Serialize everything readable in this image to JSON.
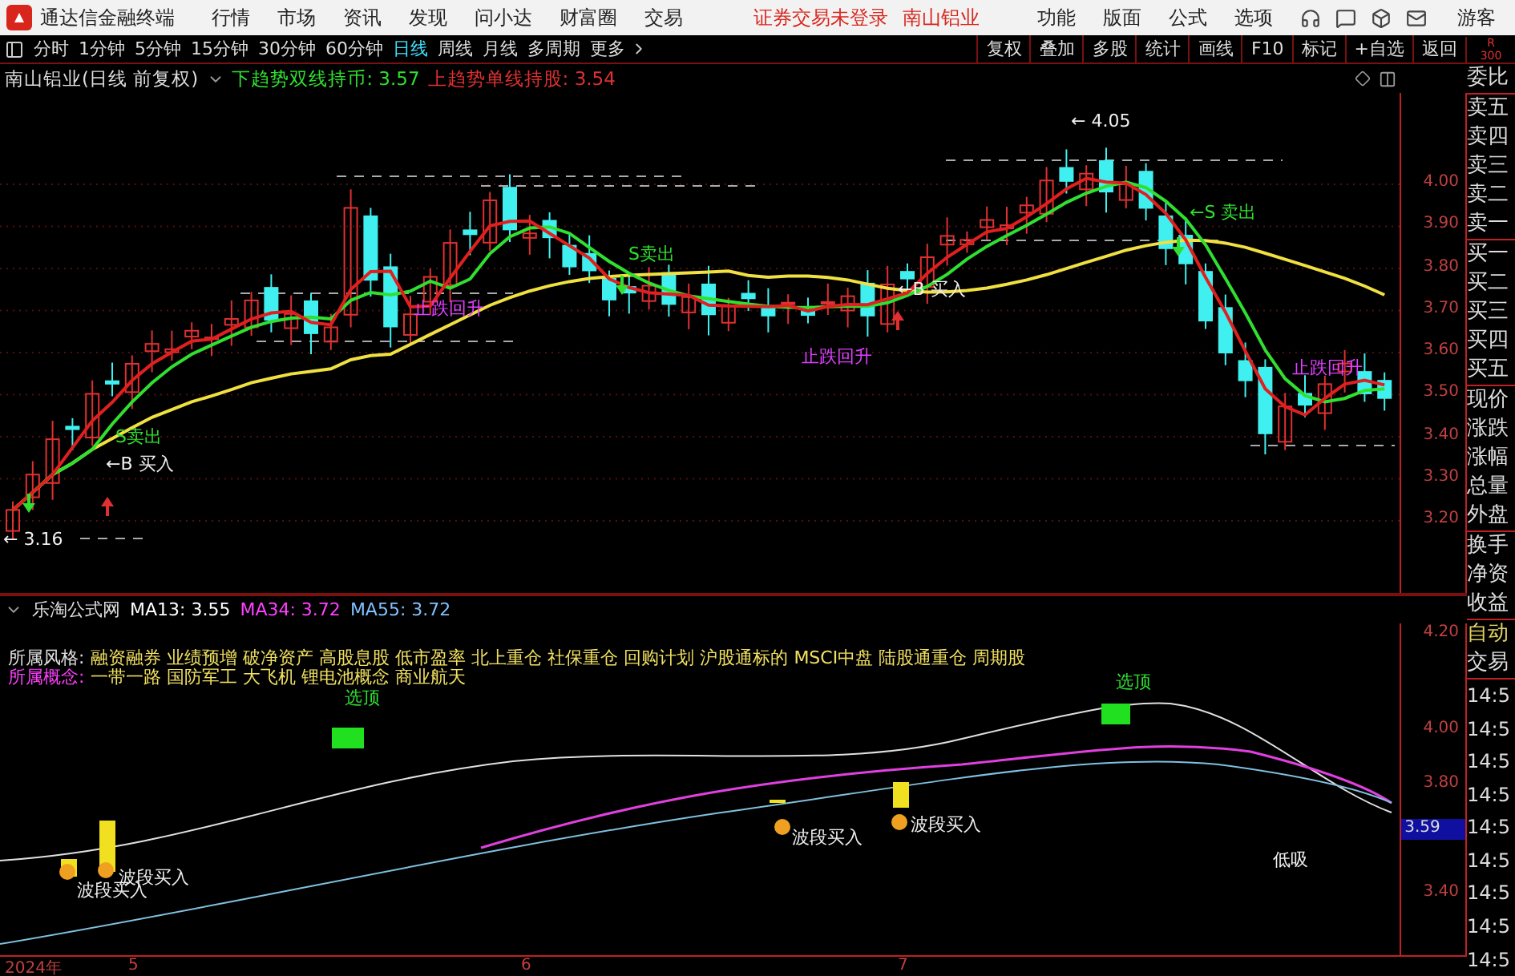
{
  "app": {
    "title": "通达信金融终端",
    "menu": [
      "行情",
      "市场",
      "资讯",
      "发现",
      "问小达",
      "财富圈",
      "交易"
    ],
    "login_status": "证券交易未登录",
    "stock_name": "南山铝业",
    "right_menu": [
      "功能",
      "版面",
      "公式",
      "选项"
    ],
    "user": "游客"
  },
  "period_bar": {
    "periods": [
      {
        "label": "分时",
        "selected": false
      },
      {
        "label": "1分钟",
        "selected": false
      },
      {
        "label": "5分钟",
        "selected": false
      },
      {
        "label": "15分钟",
        "selected": false
      },
      {
        "label": "30分钟",
        "selected": false
      },
      {
        "label": "60分钟",
        "selected": false
      },
      {
        "label": "日线",
        "selected": true
      },
      {
        "label": "周线",
        "selected": false
      },
      {
        "label": "月线",
        "selected": false
      },
      {
        "label": "多周期",
        "selected": false
      }
    ],
    "more": "更多",
    "tools": [
      "复权",
      "叠加",
      "多股",
      "统计",
      "画线",
      "F10",
      "标记",
      "+自选",
      "返回"
    ],
    "corner": [
      "R",
      "300"
    ]
  },
  "price_panel": {
    "title": "南山铝业(日线 前复权)",
    "indicators": [
      {
        "kind": "down",
        "label": "下趋势双线持币:",
        "value": "3.57"
      },
      {
        "kind": "up",
        "label": "上趋势单线持股:",
        "value": "3.54"
      }
    ],
    "y_ticks": [
      "4.00",
      "3.90",
      "3.80",
      "3.70",
      "3.60",
      "3.50",
      "3.40",
      "3.30",
      "3.20"
    ],
    "annotations": [
      {
        "kind": "low",
        "text": "← 3.16"
      },
      {
        "kind": "sell",
        "text": "S卖出"
      },
      {
        "kind": "buy",
        "text": "←B 买入"
      },
      {
        "kind": "rebound",
        "text": "止跌回升"
      },
      {
        "kind": "sell",
        "text": "S卖出"
      },
      {
        "kind": "rebound",
        "text": "止跌回升"
      },
      {
        "kind": "buy",
        "text": "←B 买入"
      },
      {
        "kind": "high",
        "text": "← 4.05"
      },
      {
        "kind": "sell",
        "text": "←S 卖出"
      },
      {
        "kind": "rebound",
        "text": "止跌回升"
      }
    ]
  },
  "indicator_panel": {
    "source": "乐淘公式网",
    "averages": [
      {
        "label": "MA13: 3.55",
        "color": "#ffffff"
      },
      {
        "label": "MA34: 3.72",
        "color": "#ff40ff"
      },
      {
        "label": "MA55: 3.72",
        "color": "#80c0ff"
      }
    ],
    "info": [
      {
        "kind": "style",
        "label": "所属风格:",
        "value": "融资融券 业绩预增 破净资产 高股息股 低市盈率 北上重仓 社保重仓 回购计划 沪股通标的 MSCI中盘 陆股通重仓 周期股"
      },
      {
        "kind": "concept",
        "label": "所属概念:",
        "value": "一带一路 国防军工 大飞机 锂电池概念 商业航天"
      }
    ],
    "y_ticks": [
      "4.20",
      "4.00",
      "3.80",
      "3.40"
    ],
    "current_value": "3.59",
    "annotations": [
      {
        "kind": "top",
        "text": "选顶"
      },
      {
        "kind": "top",
        "text": "选顶"
      },
      {
        "kind": "buy",
        "text": "波段买入"
      },
      {
        "kind": "buy",
        "text": "波段买入"
      },
      {
        "kind": "buy",
        "text": "波段买入"
      },
      {
        "kind": "buy",
        "text": "波段买入"
      },
      {
        "kind": "dip",
        "text": "低吸"
      }
    ]
  },
  "date_axis": [
    "2024年",
    "5",
    "6",
    "7"
  ],
  "quote_panel": {
    "groups": [
      [
        "委比"
      ],
      [
        "卖五",
        "卖四",
        "卖三",
        "卖二",
        "卖一"
      ],
      [
        "买一",
        "买二",
        "买三",
        "买四",
        "买五"
      ],
      [
        "现价",
        "涨跌",
        "涨幅",
        "总量",
        "外盘"
      ],
      [
        "换手",
        "净资",
        "收益"
      ]
    ],
    "auto_trade": [
      "自动",
      "交易"
    ],
    "times": [
      "14:5",
      "14:5",
      "14:5",
      "14:5",
      "14:5",
      "14:5",
      "14:5",
      "14:5",
      "14:5"
    ]
  }
}
